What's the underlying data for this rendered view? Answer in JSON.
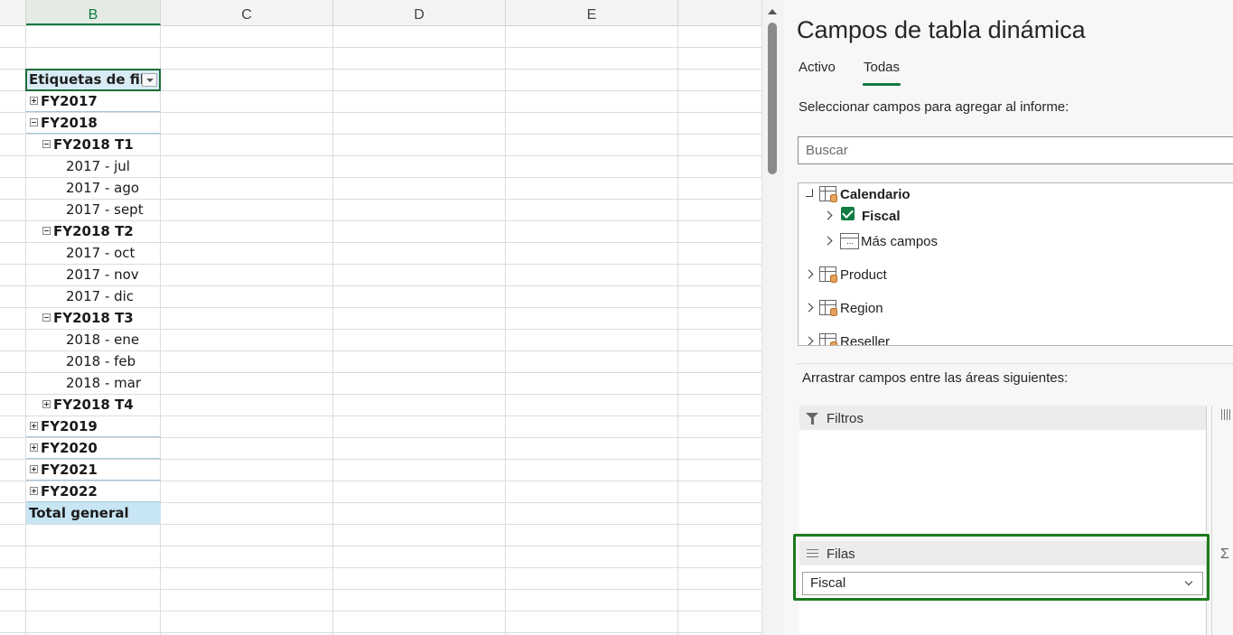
{
  "sheet": {
    "columns": [
      "B",
      "C",
      "D",
      "E"
    ],
    "selected_column": "B"
  },
  "pivot": {
    "header": "Etiquetas de fila",
    "rows": [
      {
        "label": "FY2017",
        "level": 0,
        "toggle": "plus",
        "bold": true
      },
      {
        "label": "FY2018",
        "level": 0,
        "toggle": "minus",
        "bold": true
      },
      {
        "label": "FY2018 T1",
        "level": 1,
        "toggle": "minus",
        "bold": true
      },
      {
        "label": "2017 - jul",
        "level": 2,
        "toggle": "",
        "bold": false
      },
      {
        "label": "2017 - ago",
        "level": 2,
        "toggle": "",
        "bold": false
      },
      {
        "label": "2017 - sept",
        "level": 2,
        "toggle": "",
        "bold": false
      },
      {
        "label": "FY2018 T2",
        "level": 1,
        "toggle": "minus",
        "bold": true
      },
      {
        "label": "2017 - oct",
        "level": 2,
        "toggle": "",
        "bold": false
      },
      {
        "label": "2017 - nov",
        "level": 2,
        "toggle": "",
        "bold": false
      },
      {
        "label": "2017 - dic",
        "level": 2,
        "toggle": "",
        "bold": false
      },
      {
        "label": "FY2018 T3",
        "level": 1,
        "toggle": "minus",
        "bold": true
      },
      {
        "label": "2018 - ene",
        "level": 2,
        "toggle": "",
        "bold": false
      },
      {
        "label": "2018 - feb",
        "level": 2,
        "toggle": "",
        "bold": false
      },
      {
        "label": "2018 - mar",
        "level": 2,
        "toggle": "",
        "bold": false
      },
      {
        "label": "FY2018 T4",
        "level": 1,
        "toggle": "plus",
        "bold": true
      },
      {
        "label": "FY2019",
        "level": 0,
        "toggle": "plus",
        "bold": true
      },
      {
        "label": "FY2020",
        "level": 0,
        "toggle": "plus",
        "bold": true
      },
      {
        "label": "FY2021",
        "level": 0,
        "toggle": "plus",
        "bold": true
      },
      {
        "label": "FY2022",
        "level": 0,
        "toggle": "plus",
        "bold": true
      }
    ],
    "grand_total": "Total general"
  },
  "pane": {
    "title": "Campos de tabla dinámica",
    "tabs": [
      "Activo",
      "Todas"
    ],
    "active_tab": "Todas",
    "choose_label": "Seleccionar campos para agregar al informe:",
    "search_placeholder": "Buscar",
    "fields": {
      "calendario": "Calendario",
      "fiscal": "Fiscal",
      "mas_campos": "Más campos",
      "product": "Product",
      "region": "Region",
      "reseller": "Reseller"
    },
    "drag_label": "Arrastrar campos entre las áreas siguientes:",
    "areas": {
      "filters": "Filtros",
      "rows": "Filas",
      "rows_value": "Fiscal",
      "values_symbol": "Σ"
    }
  },
  "colors": {
    "accent": "#107c41",
    "highlight": "#1e7a1e",
    "grand_total_bg": "#c7e5f3"
  }
}
